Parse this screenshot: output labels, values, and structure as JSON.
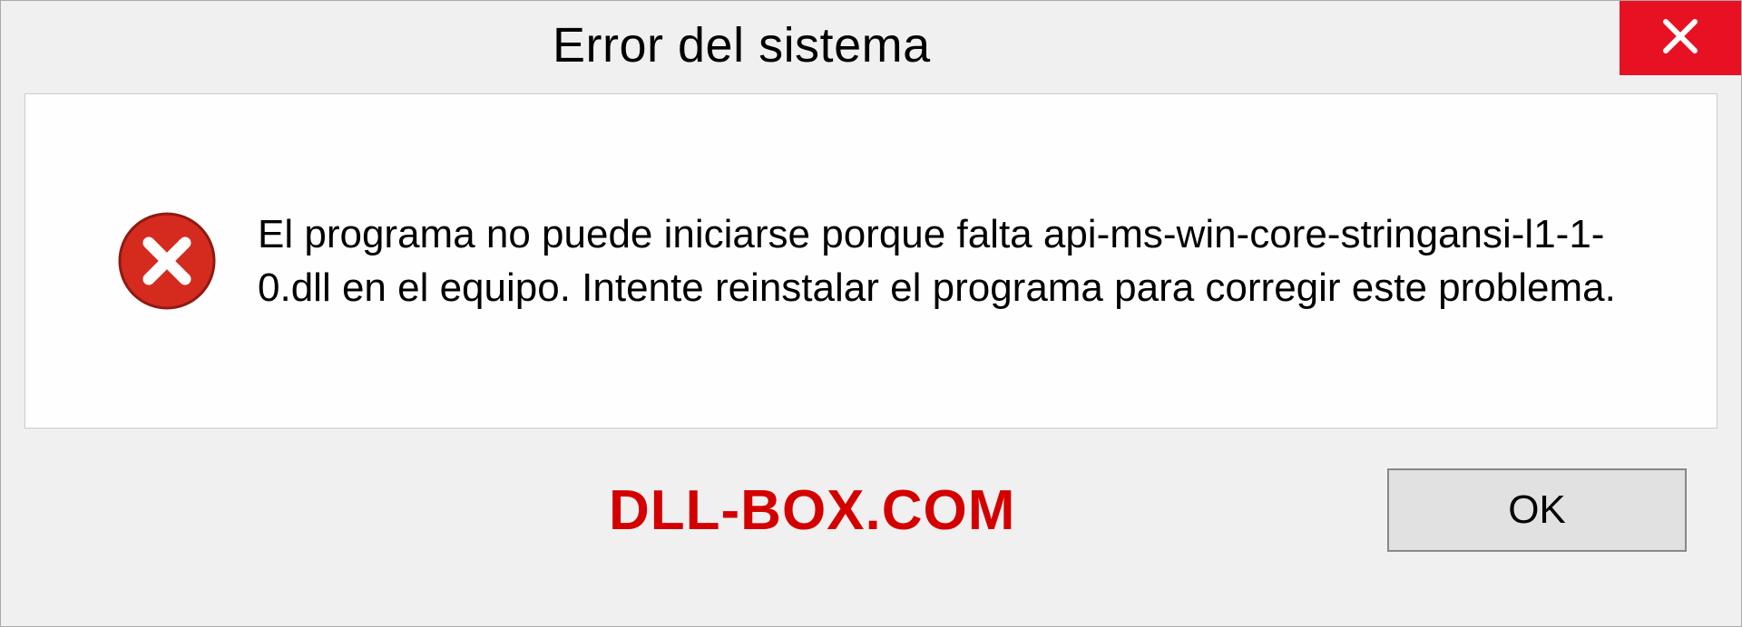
{
  "dialog": {
    "title": "Error del sistema",
    "message": "El programa no puede iniciarse porque falta api-ms-win-core-stringansi-l1-1-0.dll en el equipo. Intente reinstalar el programa para corregir este problema.",
    "ok_label": "OK",
    "watermark": "DLL-BOX.COM",
    "colors": {
      "close_bg": "#e81123",
      "error_icon": "#d52b1e",
      "watermark": "#d40000"
    }
  }
}
